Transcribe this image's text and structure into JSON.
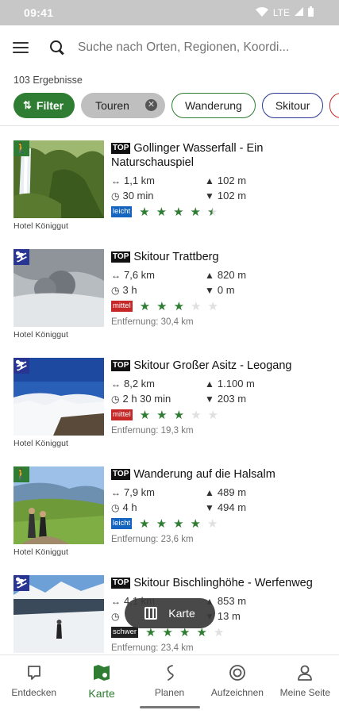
{
  "status": {
    "time": "09:41",
    "network": "LTE"
  },
  "search": {
    "placeholder": "Suche nach Orten, Regionen, Koordi..."
  },
  "results": {
    "count_label": "103 Ergebnisse"
  },
  "chips": {
    "filter": "Filter",
    "touren": "Touren",
    "wanderung": "Wanderung",
    "skitour": "Skitour"
  },
  "tours": [
    {
      "type": "hike",
      "top": "TOP",
      "title": "Gollinger Wasserfall - Ein Naturschauspiel",
      "distance": "1,1 km",
      "ascent": "102 m",
      "duration": "30 min",
      "descent": "102 m",
      "difficulty": "leicht",
      "rating": 4.5,
      "entfernung": "",
      "source": "Hotel Königgut"
    },
    {
      "type": "ski",
      "top": "TOP",
      "title": "Skitour Trattberg",
      "distance": "7,6 km",
      "ascent": "820 m",
      "duration": "3 h",
      "descent": "0 m",
      "difficulty": "mittel",
      "rating": 3,
      "entfernung": "Entfernung: 30,4 km",
      "source": "Hotel Königgut"
    },
    {
      "type": "ski",
      "top": "TOP",
      "title": "Skitour Großer Asitz - Leogang",
      "distance": "8,2 km",
      "ascent": "1.100 m",
      "duration": "2 h 30 min",
      "descent": "203 m",
      "difficulty": "mittel",
      "rating": 3,
      "entfernung": "Entfernung: 19,3 km",
      "source": "Hotel Königgut"
    },
    {
      "type": "hike",
      "top": "TOP",
      "title": "Wanderung auf die Halsalm",
      "distance": "7,9 km",
      "ascent": "489 m",
      "duration": "4 h",
      "descent": "494 m",
      "difficulty": "leicht",
      "rating": 4,
      "entfernung": "Entfernung: 23,6 km",
      "source": "Hotel Königgut"
    },
    {
      "type": "ski",
      "top": "TOP",
      "title": "Skitour Bischlinghöhe - Werfenweg",
      "distance": "4,1 km",
      "ascent": "853 m",
      "duration": "",
      "descent": "13 m",
      "difficulty": "schwer",
      "rating": 4,
      "entfernung": "Entfernung: 23,4 km",
      "source": ""
    }
  ],
  "fab": {
    "label": "Karte"
  },
  "nav": {
    "entdecken": "Entdecken",
    "karte": "Karte",
    "planen": "Planen",
    "aufzeichnen": "Aufzeichnen",
    "meine_seite": "Meine Seite"
  },
  "colors": {
    "accent": "#2e7d32",
    "ski": "#283593",
    "leicht": "#1565c0",
    "mittel": "#c62828"
  }
}
